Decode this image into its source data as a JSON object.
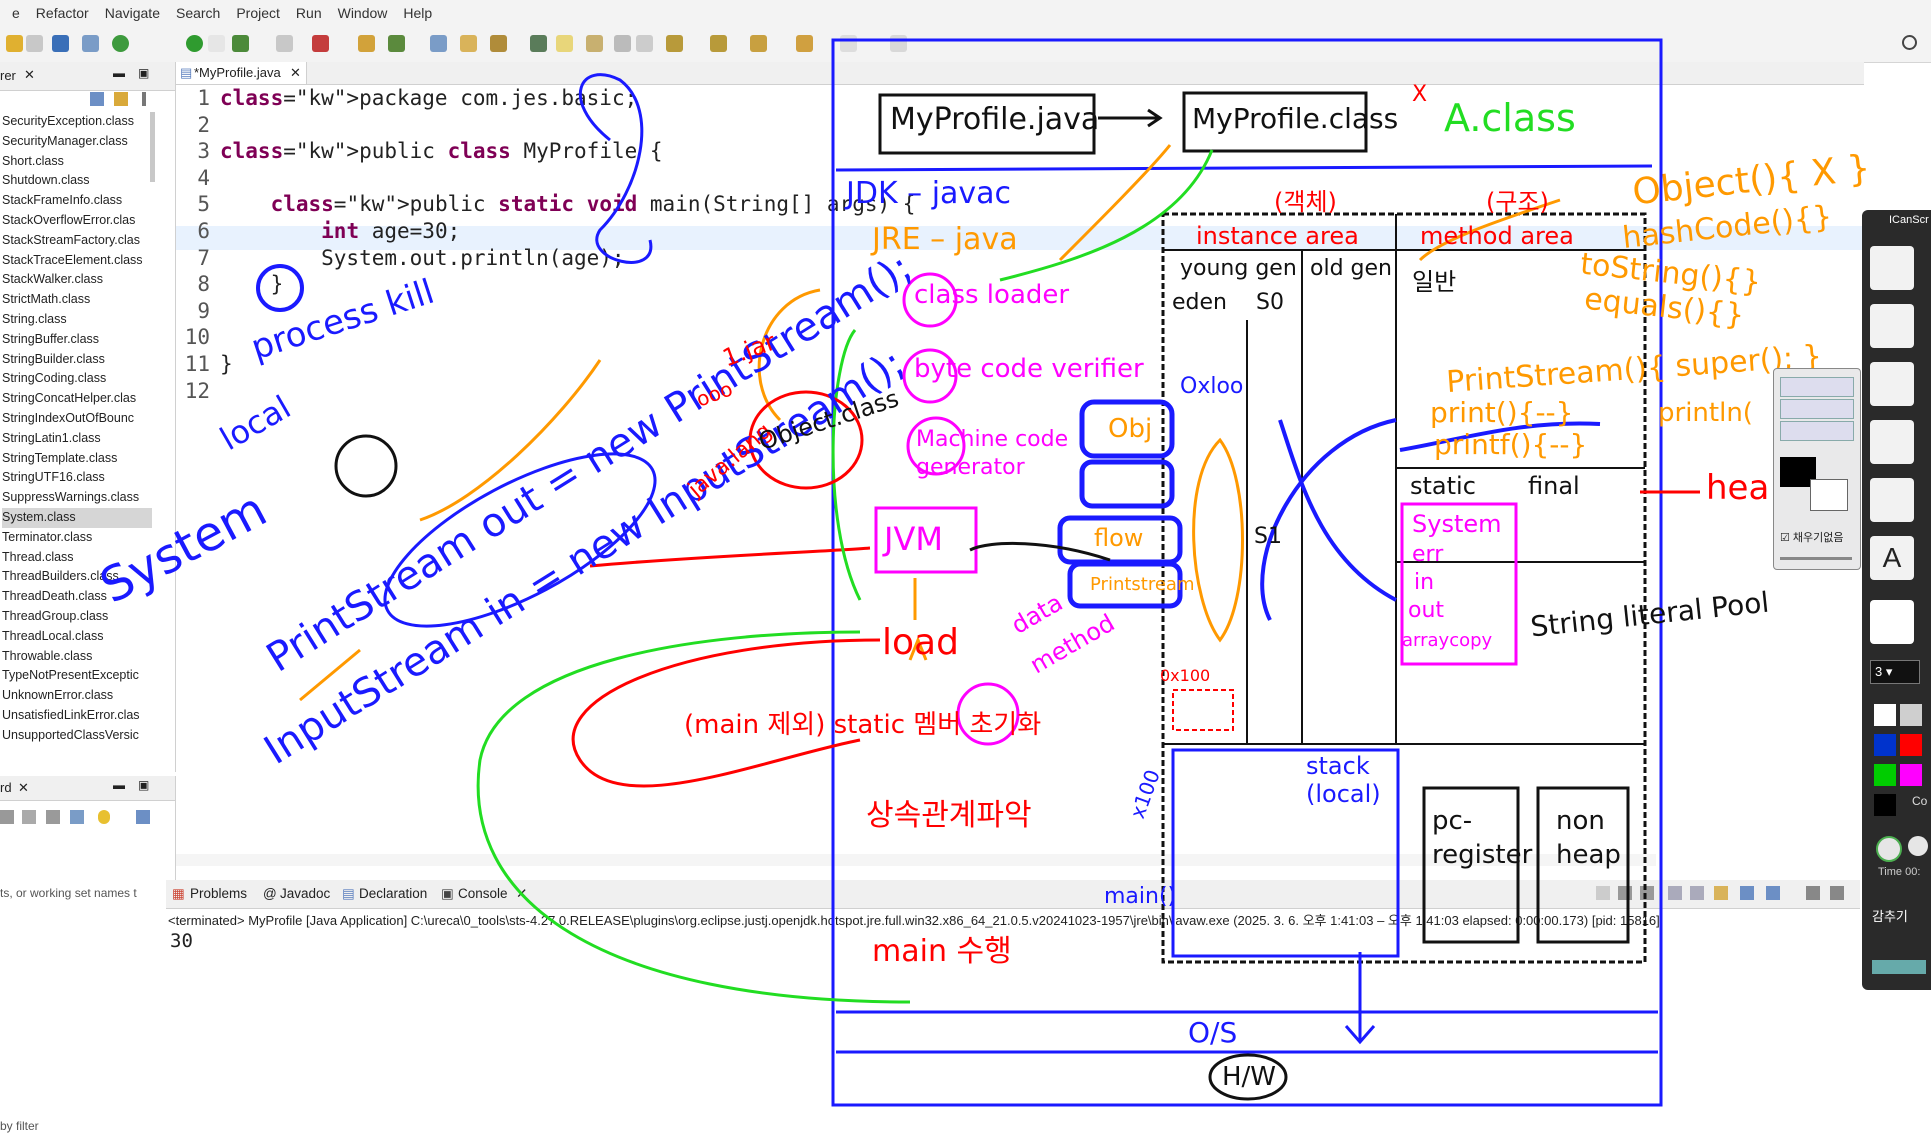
{
  "menu": [
    "e",
    "Refactor",
    "Navigate",
    "Search",
    "Project",
    "Run",
    "Window",
    "Help"
  ],
  "package_explorer": {
    "tab_label": "rer",
    "classes": [
      "SecurityException.class",
      "SecurityManager.class",
      "Short.class",
      "Shutdown.class",
      "StackFrameInfo.class",
      "StackOverflowError.clas",
      "StackStreamFactory.clas",
      "StackTraceElement.class",
      "StackWalker.class",
      "StrictMath.class",
      "String.class",
      "StringBuffer.class",
      "StringBuilder.class",
      "StringCoding.class",
      "StringConcatHelper.clas",
      "StringIndexOutOfBounc",
      "StringLatin1.class",
      "StringTemplate.class",
      "StringUTF16.class",
      "SuppressWarnings.class",
      "System.class",
      "Terminator.class",
      "Thread.class",
      "ThreadBuilders.class",
      "ThreadDeath.class",
      "ThreadGroup.class",
      "ThreadLocal.class",
      "Throwable.class",
      "TypeNotPresentExceptic",
      "UnknownError.class",
      "UnsatisfiedLinkError.clas",
      "UnsupportedClassVersic"
    ],
    "selected_index": 20,
    "filter_text": "ts, or working set names t",
    "bottom_filter": "by filter",
    "lower_tab_label": "rd"
  },
  "editor": {
    "tab_label": "*MyProfile.java",
    "lines": [
      {
        "n": "1",
        "code": "package com.jes.basic;"
      },
      {
        "n": "2",
        "code": ""
      },
      {
        "n": "3",
        "code": "public class MyProfile {"
      },
      {
        "n": "4",
        "code": ""
      },
      {
        "n": "5",
        "code": "    public static void main(String[] args) {"
      },
      {
        "n": "6",
        "code": "        int age=30;"
      },
      {
        "n": "7",
        "code": "        System.out.println(age);"
      },
      {
        "n": "8",
        "code": "    }"
      },
      {
        "n": "9",
        "code": ""
      },
      {
        "n": "10",
        "code": ""
      },
      {
        "n": "11",
        "code": "}"
      },
      {
        "n": "12",
        "code": ""
      }
    ]
  },
  "console": {
    "tabs": [
      "Problems",
      "Javadoc",
      "Declaration",
      "Console"
    ],
    "status": "<terminated> MyProfile [Java Application] C:\\ureca\\0_tools\\sts-4.27.0.RELEASE\\plugins\\org.eclipse.justj.openjdk.hotspot.jre.full.win32.x86_64_21.0.5.v20241023-1957\\jre\\bin\\javaw.exe  (2025. 3. 6. 오후 1:41:03 – 오후 1:41:03 elapsed: 0:00:00.173) [pid: 15816]",
    "output": "30"
  },
  "drawing_tool": {
    "title": "ICanScr",
    "size_value": "3",
    "checkbox_label": "채우기없음",
    "capture_label": "감추기",
    "time_label": "Time 00:",
    "color_label": "Co",
    "colors": [
      "#ffffff",
      "#cfcfcf",
      "#0033cc",
      "#ff0000",
      "#00cc00",
      "#ff00ff",
      "#000000"
    ]
  },
  "annotations": {
    "myprofile_java": "MyProfile.java",
    "myprofile_class": "MyProfile.class",
    "a_class": "A.class",
    "jdk": "JDK – javac",
    "jre": "JRE – java",
    "class_loader": "class loader",
    "byte_code_verifier": "byte code verifier",
    "machine_code": "Machine code generator",
    "jvm": "JVM",
    "load": "load",
    "static_init": "(main 제외) static 멤버 초기화",
    "inherit": "상속관계파악",
    "main_run": "main 수행",
    "instance_area": "instance area",
    "method_area": "method area",
    "object_kr": "(객체)",
    "struct_kr": "(구조)",
    "young_gen": "young gen",
    "old_gen": "old gen",
    "general_kr": "일반",
    "eden": "eden",
    "s0": "S0",
    "s1": "S1",
    "static_label": "static",
    "final_label": "final",
    "string_literal_pool": "String literal Pool",
    "stack_local": "stack (local)",
    "pc_register": "pc-register",
    "non_heap": "non heap",
    "os": "O/S",
    "hw": "H/W",
    "heap": "hea",
    "process_kill": "process kill",
    "local": "local",
    "system": "System",
    "printstream_out": "PrintStream out = new PrintStream();",
    "inputstream_in": "InputStream in = new InputStream();",
    "object_methods": "Object(){ X }",
    "hashcode": "hashCode(){}",
    "tostring": "toString(){}",
    "equals": "equals(){}",
    "printstream_ctor": "PrintStream(){ super(); }",
    "print": "print(){--}",
    "printf": "printf(){--}",
    "println": "println(",
    "system_box": "System",
    "err": "err",
    "in": "in",
    "out": "out",
    "arraycopy": "arraycopy",
    "obj": "Obj",
    "flow": "flow",
    "printstream_box": "Printstream",
    "ox100": "0x100",
    "x100": "x100",
    "main_paren": "main()",
    "data": "data",
    "method": "method",
    "ajar": "1.jar",
    "java_lang": "java.lang",
    "object_class": "Object.class",
    "ooo": "ooo",
    "x_mark": "X",
    "oxloo": "Oxloo"
  }
}
